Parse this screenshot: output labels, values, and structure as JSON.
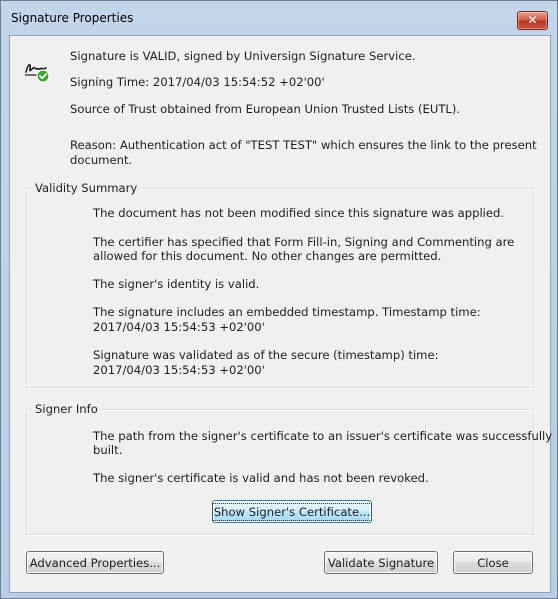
{
  "window": {
    "title": "Signature Properties",
    "close_glyph": "✕"
  },
  "header": {
    "status": "Signature is VALID, signed by Universign Signature Service.",
    "signing_time": "Signing Time:  2017/04/03 15:54:52 +02'00'",
    "source_of_trust": "Source of Trust obtained from European Union Trusted Lists (EUTL).",
    "reason_line1": "Reason:  Authentication act of \"TEST TEST\" which ensures the link to the present",
    "reason_line2": "document.",
    "icon": "signature-valid-icon"
  },
  "validity_summary": {
    "label": "Validity Summary",
    "lines": [
      "The document has not been modified since this signature was applied.",
      "The certifier has specified that Form Fill-in, Signing and Commenting are",
      "allowed for this document. No other changes are permitted.",
      "The signer's identity is valid.",
      "The signature includes an embedded timestamp. Timestamp time:",
      "2017/04/03 15:54:53 +02'00'",
      "Signature was validated as of the secure (timestamp) time:",
      "2017/04/03 15:54:53 +02'00'"
    ]
  },
  "signer_info": {
    "label": "Signer Info",
    "lines": [
      "The path from the signer's certificate to an issuer's certificate was successfully",
      "built.",
      "The signer's certificate is valid and has not been revoked."
    ],
    "show_cert_button": "Show Signer's Certificate..."
  },
  "buttons": {
    "advanced": "Advanced Properties...",
    "validate": "Validate Signature",
    "close": "Close"
  },
  "colors": {
    "check_green": "#3aa535",
    "focus_blue": "#3c7fb1"
  }
}
